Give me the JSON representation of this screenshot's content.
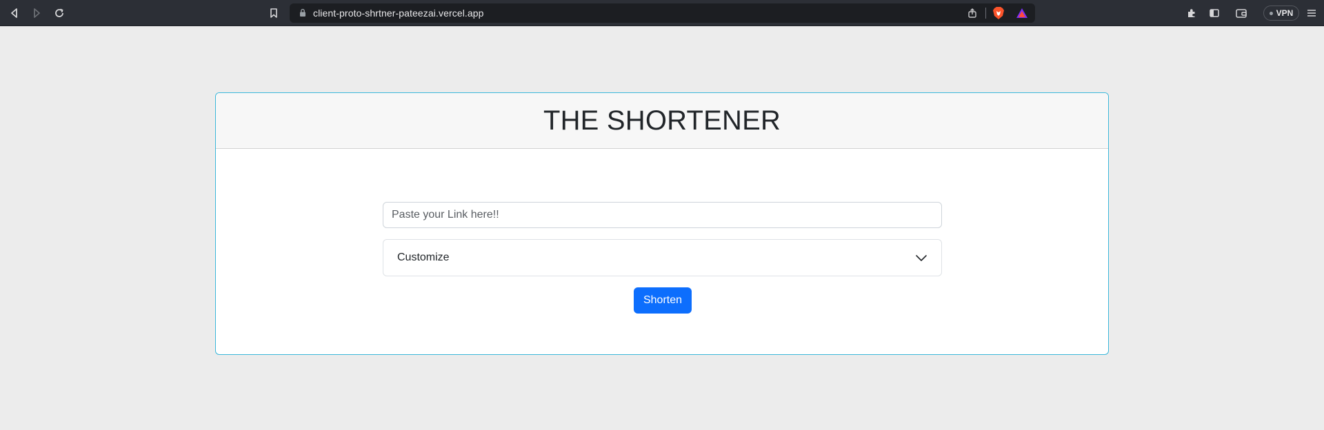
{
  "browser": {
    "url": "client-proto-shrtner-pateezai.vercel.app",
    "vpn_label": "VPN",
    "icons": [
      "back-icon",
      "forward-icon",
      "reload-icon",
      "bookmark-icon",
      "lock-icon",
      "share-icon",
      "brave-shields-icon",
      "brave-rewards-icon",
      "extensions-icon",
      "sidebar-icon",
      "wallet-icon",
      "menu-icon"
    ]
  },
  "page": {
    "title": "THE SHORTENER",
    "link_placeholder": "Paste your Link here!!",
    "customize_label": "Customize",
    "shorten_label": "Shorten"
  },
  "colors": {
    "card_border": "#3ab7da",
    "button_bg": "#0d6efd",
    "page_bg": "#ececec"
  }
}
